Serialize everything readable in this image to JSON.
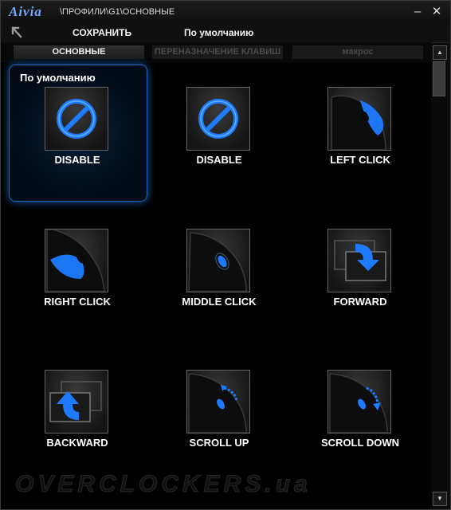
{
  "titlebar": {
    "logo": "Aivia",
    "path": "\\ПРОФИЛИ\\G1\\ОСНОВНЫЕ",
    "minimize": "–",
    "close": "✕"
  },
  "toolbar": {
    "back_icon": "back-arrow-icon",
    "save_label": "СОХРАНИТЬ",
    "default_label": "По умолчанию"
  },
  "tabs": [
    {
      "label": "ОСНОВНЫЕ",
      "active": true
    },
    {
      "label": "ПЕРЕНАЗНАЧЕНИЕ КЛАВИШ",
      "active": false
    },
    {
      "label": "макрос",
      "active": false
    }
  ],
  "profile_label": "По умолчанию",
  "buttons": [
    {
      "label": "DISABLE",
      "icon": "disable-icon",
      "selected": true
    },
    {
      "label": "DISABLE",
      "icon": "disable-icon"
    },
    {
      "label": "LEFT CLICK",
      "icon": "mouse-left-click-icon"
    },
    {
      "label": "RIGHT CLICK",
      "icon": "mouse-right-click-icon"
    },
    {
      "label": "MIDDLE CLICK",
      "icon": "mouse-middle-click-icon"
    },
    {
      "label": "FORWARD",
      "icon": "forward-icon"
    },
    {
      "label": "BACKWARD",
      "icon": "backward-icon"
    },
    {
      "label": "SCROLL UP",
      "icon": "scroll-up-icon"
    },
    {
      "label": "SCROLL DOWN",
      "icon": "scroll-down-icon"
    }
  ],
  "watermark": "OVERCLOCKERS.ua",
  "colors": {
    "accent": "#1e7bff",
    "glow": "#5ab4ff",
    "background": "#000000"
  }
}
